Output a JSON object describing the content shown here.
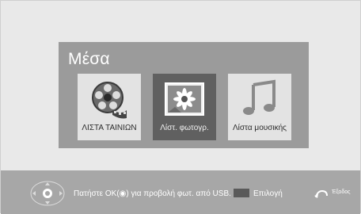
{
  "panel": {
    "title": "Μέσα",
    "tiles": [
      {
        "label": "ΛΙΣΤΑ ΤΑΙΝΙΩΝ",
        "icon": "film-reel-icon",
        "selected": false
      },
      {
        "label": "Λίστ. φωτογρ.",
        "icon": "photo-icon",
        "selected": true
      },
      {
        "label": "Λίστα μουσικής",
        "icon": "music-note-icon",
        "selected": false
      }
    ]
  },
  "bottom_bar": {
    "hint": "Πατήστε ΟΚ(◉) για προβολή φωτ. από USB.",
    "select_label": "Επιλογή",
    "exit_label": "Έξοδος",
    "key_color": "#5a5a5a"
  }
}
